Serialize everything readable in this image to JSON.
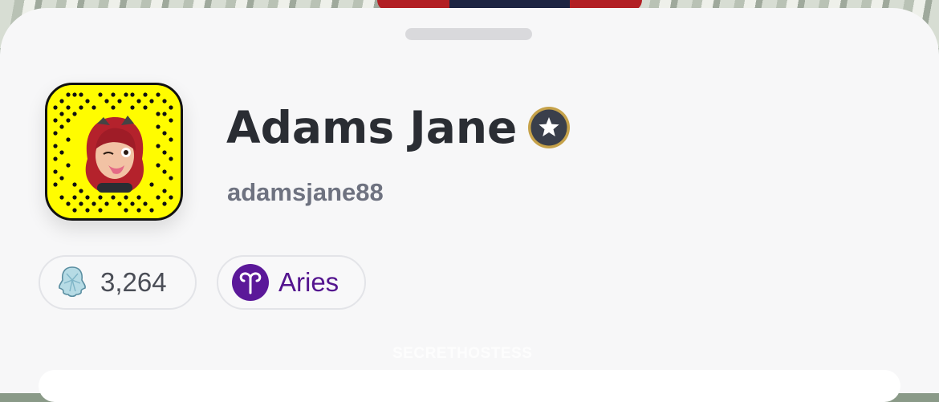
{
  "profile": {
    "display_name": "Adams Jane",
    "username": "adamsjane88",
    "badge_icon": "star-badge-icon",
    "snapcode_icon": "snapcode-bitmoji-icon"
  },
  "chips": {
    "snap_score": "3,264",
    "zodiac": "Aries",
    "score_icon": "ghost-crystal-icon",
    "zodiac_icon": "aries-icon"
  },
  "watermark": "SECRETHOSTESS",
  "colors": {
    "snapcode_yellow": "#fffc00",
    "zodiac_purple": "#54158f",
    "name_text": "#2a2d33",
    "username_text": "#6e7280"
  }
}
